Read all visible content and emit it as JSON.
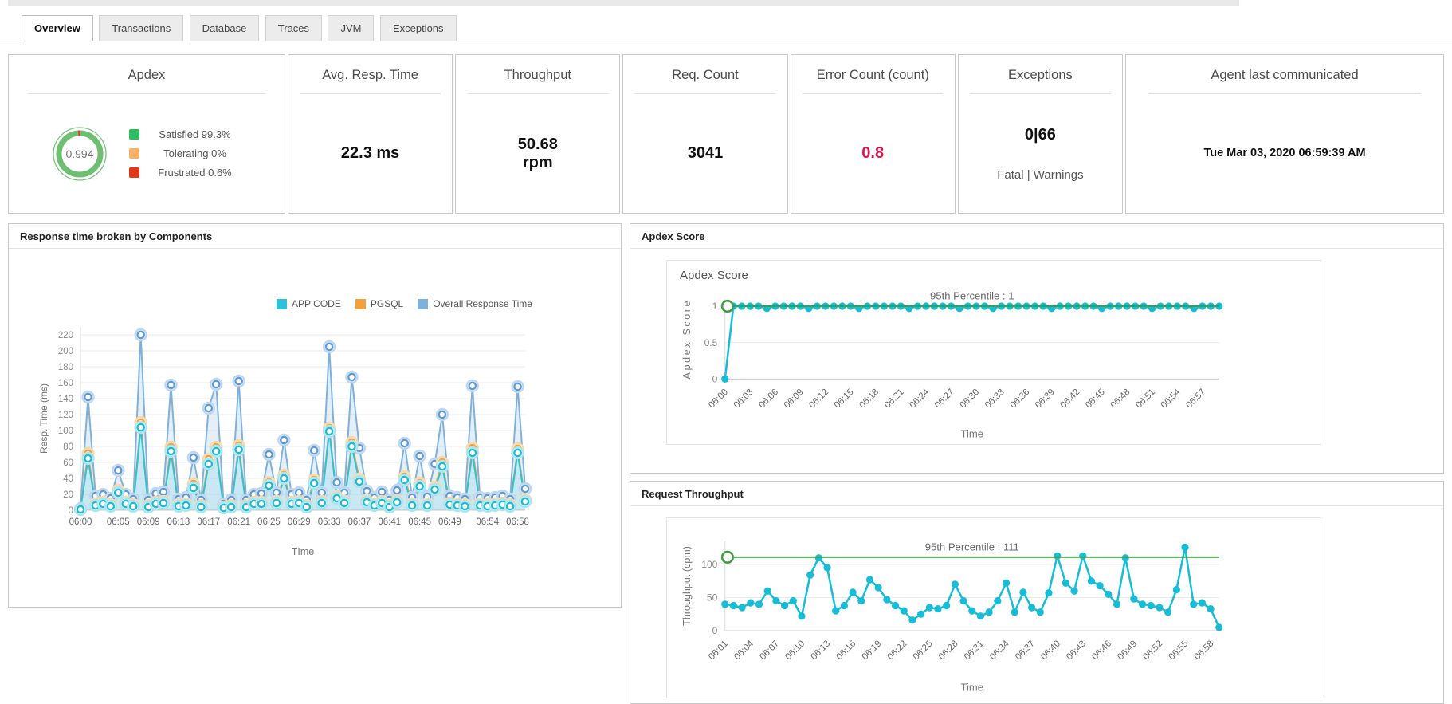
{
  "tabs": [
    {
      "label": "Overview",
      "active": true
    },
    {
      "label": "Transactions",
      "active": false
    },
    {
      "label": "Database",
      "active": false
    },
    {
      "label": "Traces",
      "active": false
    },
    {
      "label": "JVM",
      "active": false
    },
    {
      "label": "Exceptions",
      "active": false
    }
  ],
  "kpi": {
    "apdex": {
      "title": "Apdex",
      "value": "0.994",
      "ring_color": "#6fbf72",
      "ring_alert_color": "#e53935",
      "legend": [
        {
          "label": "Satisfied 99.3%",
          "color": "#2dbe60"
        },
        {
          "label": "Tolerating 0%",
          "color": "#f8b267"
        },
        {
          "label": "Frustrated 0.6%",
          "color": "#e2391b"
        }
      ]
    },
    "avg_resp_time": {
      "title": "Avg. Resp. Time",
      "value": "22.3 ms"
    },
    "throughput": {
      "title": "Throughput",
      "value_line1": "50.68",
      "value_line2": "rpm"
    },
    "req_count": {
      "title": "Req. Count",
      "value": "3041"
    },
    "error_count": {
      "title": "Error Count (count)",
      "value": "0.8",
      "color": "#e0164f"
    },
    "exceptions": {
      "title": "Exceptions",
      "value": "0|66",
      "subtitle": "Fatal | Warnings"
    },
    "agent": {
      "title": "Agent last communicated",
      "value": "Tue Mar 03, 2020 06:59:39 AM"
    }
  },
  "panels": {
    "response_components": {
      "title": "Response time broken by Components"
    },
    "apdex_score": {
      "title": "Apdex Score",
      "inner_title": "Apdex Score"
    },
    "request_throughput": {
      "title": "Request Throughput"
    }
  },
  "chart_data": [
    {
      "id": "components",
      "type": "line",
      "title": "Response time broken by Components",
      "xlabel": "TIme",
      "ylabel": "Resp. Time (ms)",
      "ylim": [
        0,
        230
      ],
      "yticks": [
        0,
        20,
        40,
        60,
        80,
        100,
        120,
        140,
        160,
        180,
        200,
        220
      ],
      "grid": true,
      "legend_position": "top-center",
      "x": [
        "06:00",
        "06:01",
        "06:02",
        "06:03",
        "06:04",
        "06:05",
        "06:06",
        "06:07",
        "06:08",
        "06:09",
        "06:10",
        "06:11",
        "06:12",
        "06:13",
        "06:14",
        "06:15",
        "06:16",
        "06:17",
        "06:18",
        "06:19",
        "06:20",
        "06:21",
        "06:22",
        "06:23",
        "06:24",
        "06:25",
        "06:26",
        "06:27",
        "06:28",
        "06:29",
        "06:30",
        "06:31",
        "06:32",
        "06:33",
        "06:34",
        "06:35",
        "06:36",
        "06:37",
        "06:38",
        "06:39",
        "06:40",
        "06:41",
        "06:42",
        "06:43",
        "06:44",
        "06:45",
        "06:46",
        "06:47",
        "06:48",
        "06:49",
        "06:50",
        "06:51",
        "06:52",
        "06:53",
        "06:54",
        "06:55",
        "06:56",
        "06:57",
        "06:58",
        "06:59"
      ],
      "xticks": [
        "06:00",
        "06:05",
        "06:09",
        "06:13",
        "06:17",
        "06:21",
        "06:25",
        "06:29",
        "06:33",
        "06:37",
        "06:41",
        "06:45",
        "06:49",
        "06:54",
        "06:58"
      ],
      "series": [
        {
          "name": "Overall Response Time",
          "color": "#7fb1dd",
          "marker": "#5f9bd2",
          "halo": "#bed7ee",
          "area": "rgba(127,177,221,0.20)",
          "values": [
            2,
            142,
            18,
            20,
            15,
            50,
            20,
            14,
            220,
            13,
            21,
            23,
            157,
            14,
            16,
            66,
            13,
            128,
            158,
            8,
            13,
            162,
            13,
            20,
            21,
            70,
            22,
            88,
            20,
            22,
            13,
            75,
            22,
            205,
            35,
            22,
            167,
            78,
            24,
            16,
            23,
            13,
            25,
            84,
            16,
            68,
            17,
            58,
            120,
            18,
            16,
            14,
            156,
            16,
            15,
            16,
            18,
            14,
            155,
            27
          ]
        },
        {
          "name": "PGSQL",
          "color": "#f0a23f",
          "marker": "#f0a23f",
          "halo": "#f8d9ab",
          "area": null,
          "values": [
            1,
            71,
            8,
            10,
            7,
            25,
            10,
            7,
            110,
            6,
            10,
            11,
            79,
            7,
            8,
            33,
            6,
            64,
            79,
            4,
            6,
            81,
            6,
            10,
            10,
            35,
            11,
            44,
            10,
            11,
            6,
            38,
            11,
            103,
            17,
            11,
            85,
            39,
            12,
            8,
            11,
            6,
            12,
            42,
            8,
            34,
            8,
            29,
            60,
            9,
            8,
            7,
            78,
            8,
            7,
            8,
            9,
            7,
            77,
            13
          ]
        },
        {
          "name": "APP CODE",
          "color": "#2ec1d7",
          "marker": "#23b9d0",
          "halo": "#ace5ee",
          "area": "rgba(46,193,215,0.14)",
          "values": [
            1,
            65,
            6,
            8,
            5,
            22,
            8,
            5,
            104,
            4,
            8,
            9,
            74,
            5,
            6,
            28,
            4,
            58,
            74,
            3,
            4,
            76,
            4,
            8,
            8,
            31,
            9,
            40,
            8,
            9,
            4,
            34,
            9,
            99,
            15,
            9,
            80,
            36,
            10,
            6,
            9,
            4,
            10,
            38,
            6,
            30,
            6,
            26,
            55,
            7,
            6,
            5,
            72,
            6,
            5,
            6,
            7,
            5,
            72,
            11
          ]
        }
      ]
    },
    {
      "id": "apdex_score",
      "type": "line",
      "title": "Apdex Score",
      "xlabel": "Time",
      "ylabel": "Apdex Score",
      "ylim": [
        0,
        1.1
      ],
      "yticks": [
        0,
        0.5,
        1
      ],
      "grid": true,
      "percentile": {
        "label": "95th Percentile : 1",
        "value": 1,
        "color": "#3f9c43"
      },
      "x": [
        "06:00",
        "06:01",
        "06:02",
        "06:03",
        "06:04",
        "06:05",
        "06:06",
        "06:07",
        "06:08",
        "06:09",
        "06:10",
        "06:11",
        "06:12",
        "06:13",
        "06:14",
        "06:15",
        "06:16",
        "06:17",
        "06:18",
        "06:19",
        "06:20",
        "06:21",
        "06:22",
        "06:23",
        "06:24",
        "06:25",
        "06:26",
        "06:27",
        "06:28",
        "06:29",
        "06:30",
        "06:31",
        "06:32",
        "06:33",
        "06:34",
        "06:35",
        "06:36",
        "06:37",
        "06:38",
        "06:39",
        "06:40",
        "06:41",
        "06:42",
        "06:43",
        "06:44",
        "06:45",
        "06:46",
        "06:47",
        "06:48",
        "06:49",
        "06:50",
        "06:51",
        "06:52",
        "06:53",
        "06:54",
        "06:55",
        "06:56",
        "06:57",
        "06:58",
        "06:59"
      ],
      "xticks": [
        "06:00",
        "06:03",
        "06:06",
        "06:09",
        "06:12",
        "06:15",
        "06:18",
        "06:21",
        "06:24",
        "06:27",
        "06:30",
        "06:33",
        "06:36",
        "06:39",
        "06:42",
        "06:45",
        "06:48",
        "06:51",
        "06:54",
        "06:57"
      ],
      "series": [
        {
          "name": "Apdex Score",
          "color": "#17bcd6",
          "marker": "#17bcd6",
          "values": [
            0,
            1,
            1,
            1,
            1,
            0.97,
            1,
            1,
            1,
            1,
            0.97,
            1,
            1,
            1,
            1,
            1,
            0.97,
            1,
            1,
            1,
            1,
            1,
            0.97,
            1,
            1,
            1,
            1,
            1,
            0.97,
            1,
            1,
            1,
            0.97,
            1,
            1,
            1,
            1,
            1,
            1,
            0.97,
            1,
            1,
            1,
            1,
            1,
            0.97,
            1,
            1,
            1,
            1,
            1,
            0.97,
            1,
            1,
            1,
            1,
            0.97,
            1,
            1,
            1
          ]
        }
      ]
    },
    {
      "id": "request_throughput",
      "type": "line",
      "title": "Request Throughput",
      "xlabel": "Time",
      "ylabel": "Throughput (cpm)",
      "ylim": [
        0,
        135
      ],
      "yticks": [
        0,
        50,
        100
      ],
      "grid": true,
      "percentile": {
        "label": "95th Percentile : 111",
        "value": 111,
        "color": "#3f9c43"
      },
      "x": [
        "06:01",
        "06:02",
        "06:03",
        "06:04",
        "06:05",
        "06:06",
        "06:07",
        "06:08",
        "06:09",
        "06:10",
        "06:11",
        "06:12",
        "06:13",
        "06:14",
        "06:15",
        "06:16",
        "06:17",
        "06:18",
        "06:19",
        "06:20",
        "06:21",
        "06:22",
        "06:23",
        "06:24",
        "06:25",
        "06:26",
        "06:27",
        "06:28",
        "06:29",
        "06:30",
        "06:31",
        "06:32",
        "06:33",
        "06:34",
        "06:35",
        "06:36",
        "06:37",
        "06:38",
        "06:39",
        "06:40",
        "06:41",
        "06:42",
        "06:43",
        "06:44",
        "06:45",
        "06:46",
        "06:47",
        "06:48",
        "06:49",
        "06:50",
        "06:51",
        "06:52",
        "06:53",
        "06:54",
        "06:55",
        "06:56",
        "06:57",
        "06:58",
        "06:59"
      ],
      "xticks": [
        "06:01",
        "06:04",
        "06:07",
        "06:10",
        "06:13",
        "06:16",
        "06:19",
        "06:22",
        "06:25",
        "06:28",
        "06:31",
        "06:34",
        "06:37",
        "06:40",
        "06:43",
        "06:46",
        "06:49",
        "06:52",
        "06:55",
        "06:58"
      ],
      "series": [
        {
          "name": "Request Throughput",
          "color": "#17bcd6",
          "marker": "#17bcd6",
          "values": [
            40,
            38,
            35,
            42,
            40,
            60,
            45,
            38,
            45,
            22,
            84,
            110,
            95,
            30,
            38,
            58,
            45,
            77,
            65,
            47,
            38,
            30,
            16,
            25,
            35,
            33,
            38,
            70,
            45,
            30,
            22,
            28,
            45,
            72,
            28,
            58,
            35,
            28,
            57,
            113,
            72,
            60,
            113,
            75,
            68,
            55,
            40,
            110,
            48,
            40,
            38,
            35,
            28,
            62,
            126,
            40,
            42,
            33,
            5
          ]
        }
      ]
    }
  ]
}
